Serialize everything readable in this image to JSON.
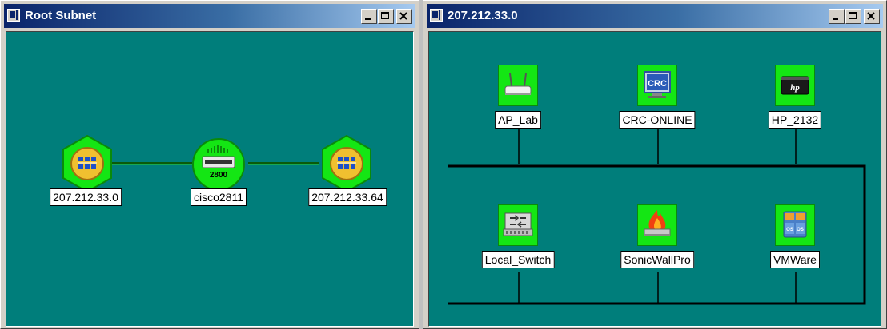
{
  "window_root": {
    "title": "Root Subnet",
    "nodes": [
      {
        "label": "207.212.33.0",
        "icon": "subnet-icon"
      },
      {
        "label": "cisco2811",
        "icon": "router-icon",
        "badge": "2800"
      },
      {
        "label": "207.212.33.64",
        "icon": "subnet-icon"
      }
    ]
  },
  "window_subnet": {
    "title": "207.212.33.0",
    "nodes": [
      {
        "label": "AP_Lab",
        "icon": "wireless-ap-icon"
      },
      {
        "label": "CRC-ONLINE",
        "icon": "crc-monitor-icon",
        "badge": "CRC"
      },
      {
        "label": "HP_2132",
        "icon": "hp-device-icon",
        "badge": "hp"
      },
      {
        "label": "Local_Switch",
        "icon": "switch-icon"
      },
      {
        "label": "SonicWallPro",
        "icon": "firewall-icon"
      },
      {
        "label": "VMWare",
        "icon": "vmware-icon",
        "badge": "OS"
      }
    ]
  },
  "colors": {
    "canvas": "#007e7b",
    "node_green": "#14e614",
    "title_bar": "#0a246a"
  }
}
